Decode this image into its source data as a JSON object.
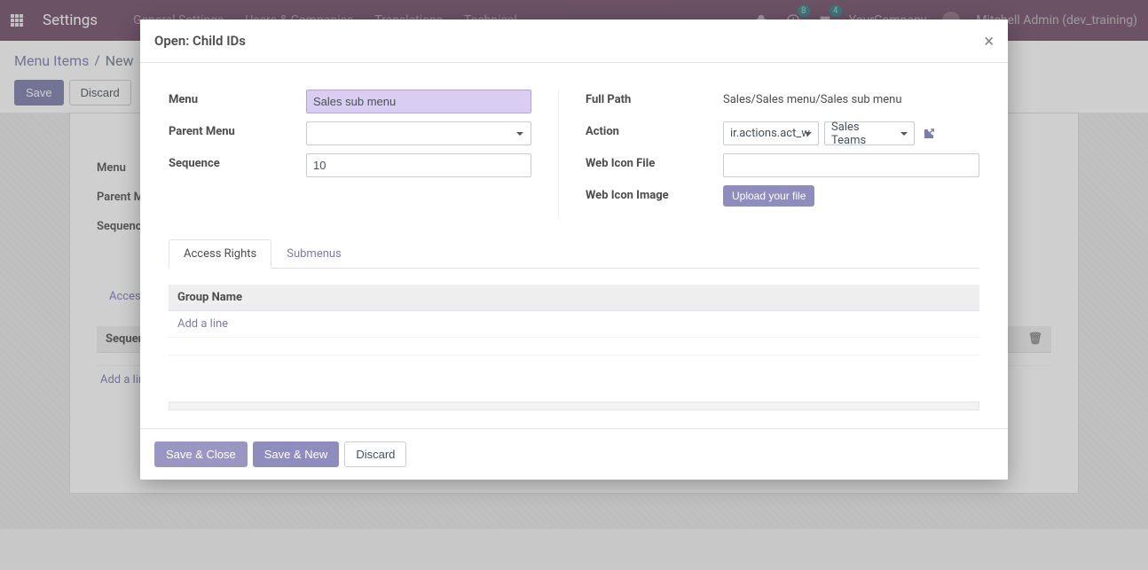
{
  "navbar": {
    "title": "Settings",
    "menu": [
      "General Settings",
      "Users & Companies",
      "Translations",
      "Technical"
    ],
    "badge1": "8",
    "badge2": "4",
    "company": "YourCompany",
    "user": "Mitchell Admin (dev_training)"
  },
  "breadcrumb": {
    "link": "Menu Items",
    "current": "New"
  },
  "buttons": {
    "save": "Save",
    "discard": "Discard"
  },
  "bg_form": {
    "menu_label": "Menu",
    "parent_menu_label": "Parent Menu",
    "sequence_label": "Sequence",
    "tab_access": "Access Rights",
    "seq_header": "Sequence",
    "add_line": "Add a line"
  },
  "modal": {
    "title": "Open: Child IDs",
    "close": "×",
    "labels": {
      "menu": "Menu",
      "parent_menu": "Parent Menu",
      "sequence": "Sequence",
      "full_path": "Full Path",
      "action": "Action",
      "web_icon_file": "Web Icon File",
      "web_icon_image": "Web Icon Image"
    },
    "values": {
      "menu": "Sales sub menu",
      "parent_menu": "",
      "sequence": "10",
      "full_path": "Sales/Sales menu/Sales sub menu",
      "action_type": "ir.actions.act_w",
      "action_name": "Sales Teams",
      "web_icon_file": ""
    },
    "upload_label": "Upload your file",
    "tabs": {
      "access_rights": "Access Rights",
      "submenus": "Submenus"
    },
    "table": {
      "group_name_header": "Group Name",
      "add_line": "Add a line"
    },
    "footer": {
      "save_close": "Save & Close",
      "save_new": "Save & New",
      "discard": "Discard"
    }
  }
}
